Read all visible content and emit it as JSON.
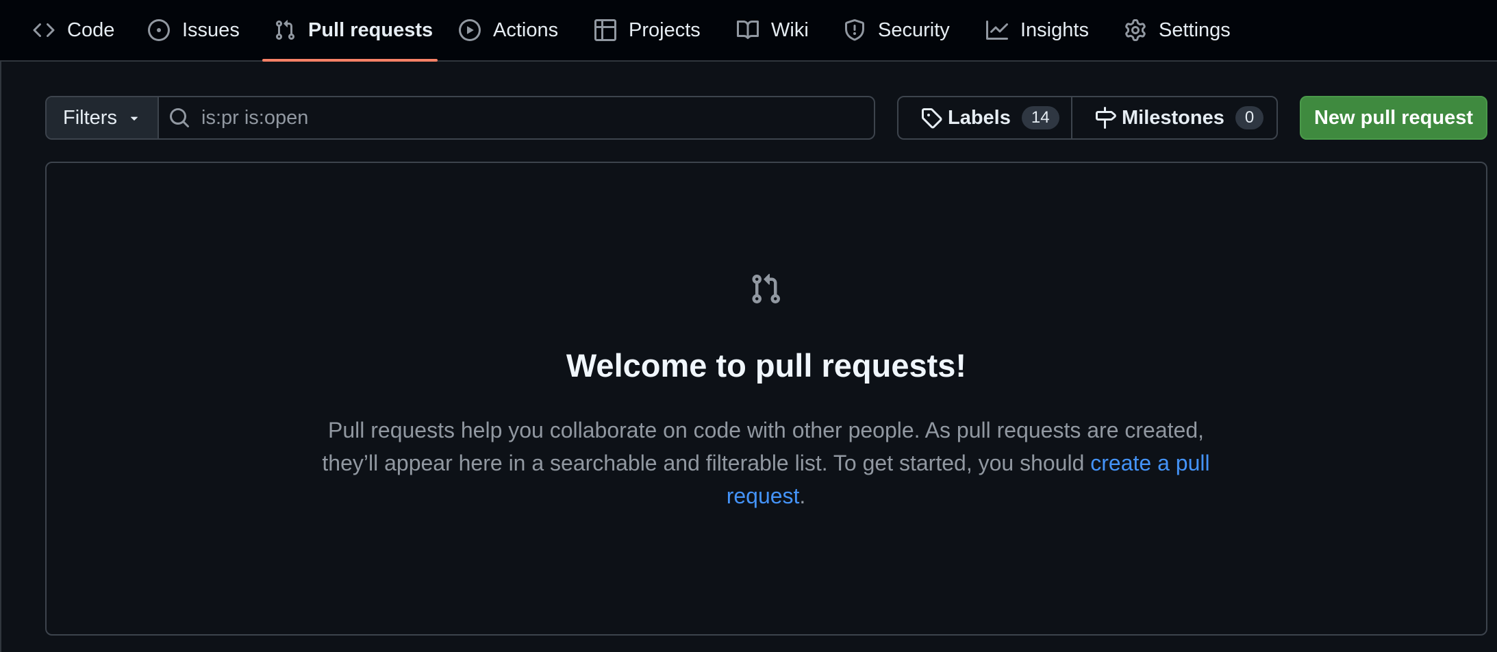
{
  "nav": {
    "tabs": [
      {
        "label": "Code",
        "icon": "code-icon"
      },
      {
        "label": "Issues",
        "icon": "issue-opened-icon"
      },
      {
        "label": "Pull requests",
        "icon": "git-pull-request-icon",
        "selected": true
      },
      {
        "label": "Actions",
        "icon": "play-icon"
      },
      {
        "label": "Projects",
        "icon": "table-icon"
      },
      {
        "label": "Wiki",
        "icon": "book-icon"
      },
      {
        "label": "Security",
        "icon": "shield-icon"
      },
      {
        "label": "Insights",
        "icon": "graph-icon"
      },
      {
        "label": "Settings",
        "icon": "gear-icon"
      }
    ],
    "underline_color": "#f78166"
  },
  "toolbar": {
    "filters_label": "Filters",
    "search_placeholder": "is:pr is:open",
    "labels_label": "Labels",
    "labels_count": "14",
    "milestones_label": "Milestones",
    "milestones_count": "0",
    "new_pr_label": "New pull request",
    "new_pr_color": "#3f8a3f"
  },
  "blankslate": {
    "icon": "git-pull-request-icon",
    "title": "Welcome to pull requests!",
    "description": "Pull requests help you collaborate on code with other people. As pull requests are created, they’ll appear here in a searchable and filterable list. To get started, you should ",
    "link_text": "create a pull request",
    "suffix": ".",
    "link_color": "#4493f8"
  },
  "colors": {
    "background": "#0d1117",
    "nav_background": "#010409",
    "border": "#3d444d",
    "muted_text": "#9198a1"
  }
}
